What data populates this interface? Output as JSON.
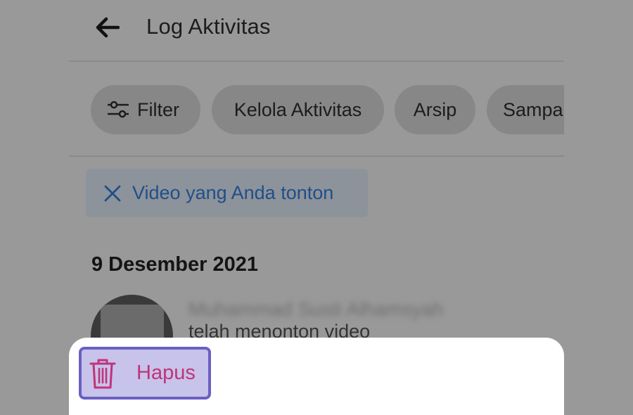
{
  "header": {
    "back_icon": "arrow-left-icon",
    "title": "Log Aktivitas"
  },
  "chips": {
    "filter": {
      "label": "Filter",
      "icon": "sliders-icon"
    },
    "kelola": {
      "label": "Kelola Aktivitas"
    },
    "arsip": {
      "label": "Arsip"
    },
    "sampah": {
      "label": "Sampah"
    }
  },
  "active_filter": {
    "label": "Video yang Anda tonton",
    "icon": "close-icon"
  },
  "section": {
    "date": "9 Desember 2021"
  },
  "activity": {
    "user_name": "Muhammad Susti Alhamsyah",
    "text": "telah menonton video"
  },
  "bottom_sheet": {
    "delete_label": "Hapus",
    "delete_icon": "trash-icon"
  },
  "colors": {
    "overlay_background": "#999999",
    "chip_background": "#878787",
    "filter_text": "#1f4f8a",
    "delete_text": "#c0337a",
    "highlight_border": "#6a5fc4",
    "highlight_fill": "#c7c3ea"
  }
}
